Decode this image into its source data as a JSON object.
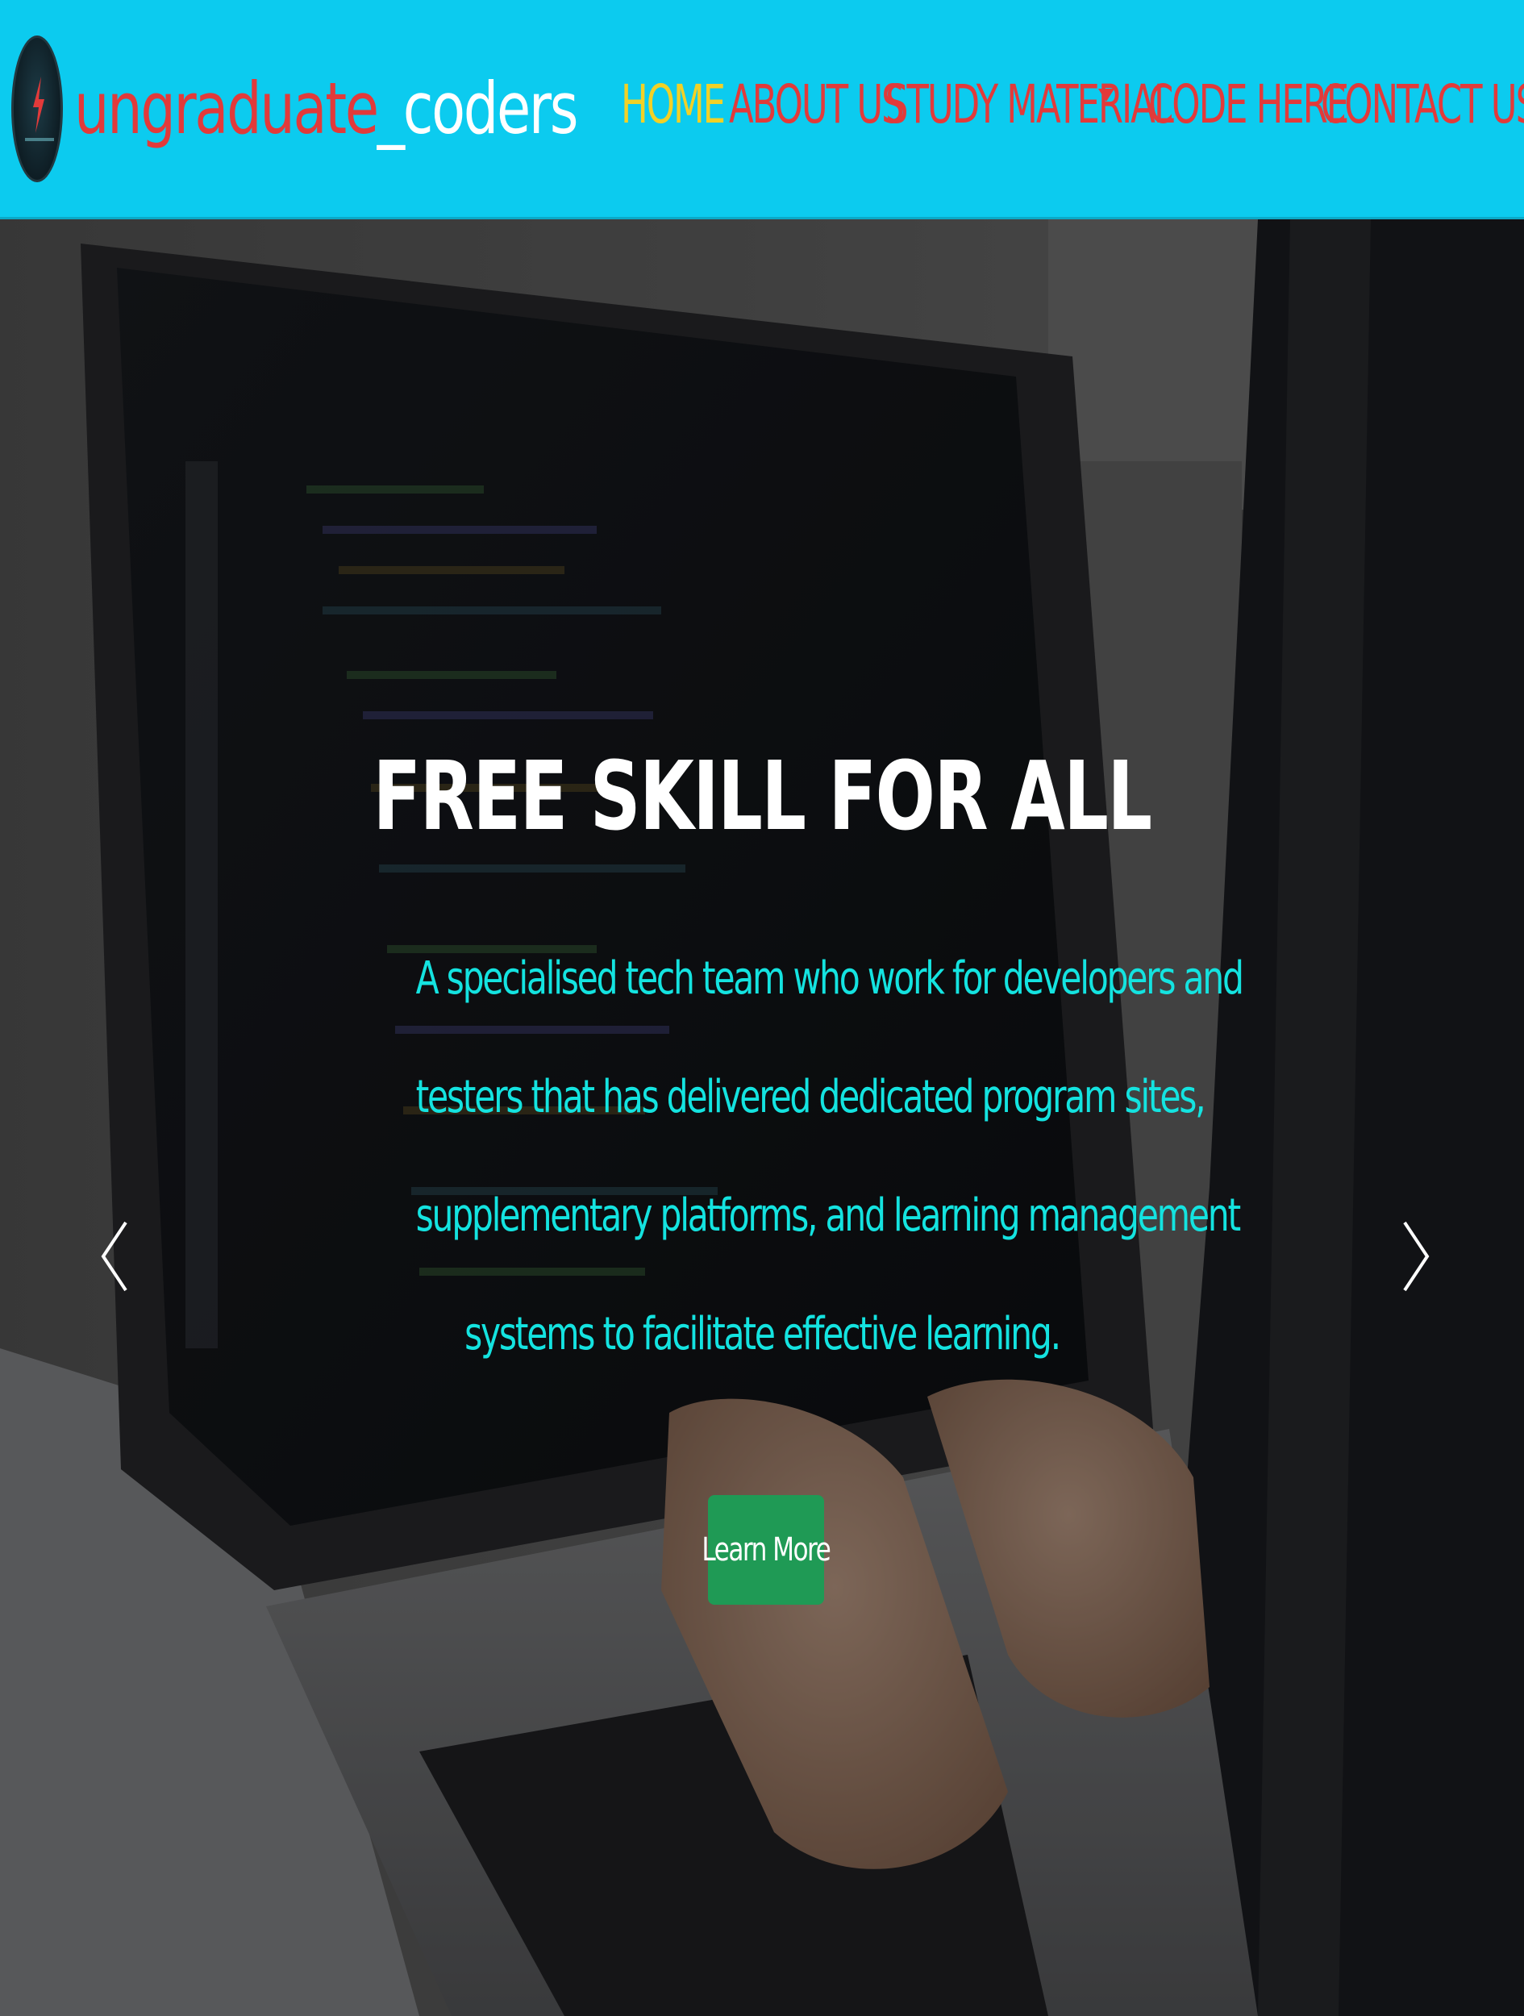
{
  "brand": {
    "name_part1": "ungraduate",
    "name_part2": "_coders",
    "logo_icon": "bolt-logo-icon"
  },
  "nav": {
    "items": [
      {
        "label": "HOME",
        "active": true
      },
      {
        "label": "ABOUT US",
        "active": false
      },
      {
        "label": "STUDY MATERIAL",
        "active": false,
        "has_dropdown": true
      },
      {
        "label": "CODE HERE",
        "active": false
      },
      {
        "label": "CONTACT US",
        "active": false
      }
    ]
  },
  "hero": {
    "title": "FREE SKILL FOR ALL",
    "description_lines": [
      "A specialised tech team who work for developers and",
      "testers that has delivered dedicated program sites,",
      "supplementary platforms, and learning management",
      "systems to facilitate effective learning."
    ],
    "cta_label": "Learn More",
    "prev_icon": "chevron-left-icon",
    "next_icon": "chevron-right-icon"
  },
  "colors": {
    "navbar_bg": "#0ccbef",
    "nav_active": "#f2d126",
    "nav_text": "#e23a3a",
    "brand_primary": "#e23a3a",
    "brand_secondary": "#ffffff",
    "hero_title": "#ffffff",
    "hero_desc": "#14e3e0",
    "cta_bg": "#1f9a55"
  }
}
